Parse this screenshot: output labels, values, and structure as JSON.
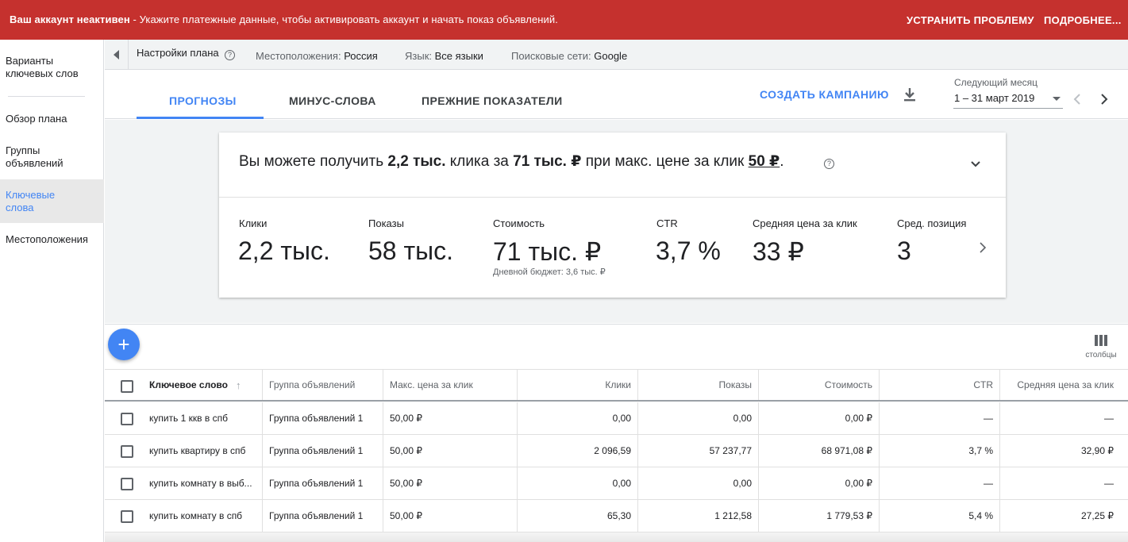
{
  "alert": {
    "title": "Ваш аккаунт неактивен",
    "message": " - Укажите платежные данные, чтобы активировать аккаунт и начать показ объявлений.",
    "fix_label": "УСТРАНИТЬ ПРОБЛЕМУ",
    "more_label": "ПОДРОБНЕЕ...",
    "color": "#c5312e"
  },
  "sidebar": {
    "items": [
      {
        "label": "Варианты ключевых слов"
      },
      {
        "label": "Обзор плана"
      },
      {
        "label": "Группы объявлений"
      },
      {
        "label": "Ключевые слова"
      },
      {
        "label": "Местоположения"
      }
    ]
  },
  "plan_bar": {
    "title": "Настройки плана",
    "location_label": "Местоположения:",
    "location_value": "Россия",
    "language_label": "Язык:",
    "language_value": "Все языки",
    "network_label": "Поисковые сети:",
    "network_value": "Google"
  },
  "tabs": [
    {
      "label": "ПРОГНОЗЫ"
    },
    {
      "label": "МИНУС-СЛОВА"
    },
    {
      "label": "ПРЕЖНИЕ ПОКАЗАТЕЛИ"
    }
  ],
  "header": {
    "create_label": "СОЗДАТЬ КАМПАНИЮ",
    "period_label": "Следующий месяц",
    "period_value": "1 – 31 март 2019",
    "accent": "#4285f4"
  },
  "forecast": {
    "headline_1": "Вы можете получить ",
    "clicks": "2,2 тыс.",
    "headline_2": " клика за ",
    "cost": "71 тыс. ₽",
    "headline_3": " при макс. цене за клик ",
    "max_cpc": "50 ₽",
    "headline_4": ".",
    "metrics": [
      {
        "label": "Клики",
        "value": "2,2 тыс."
      },
      {
        "label": "Показы",
        "value": "58 тыс."
      },
      {
        "label": "Стоимость",
        "value": "71 тыс. ₽",
        "sub": "Дневной бюджет: 3,6 тыс. ₽"
      },
      {
        "label": "CTR",
        "value": "3,7 %"
      },
      {
        "label": "Средняя цена за клик",
        "value": "33 ₽"
      },
      {
        "label": "Сред. позиция",
        "value": "3"
      }
    ]
  },
  "table": {
    "columns_label": "столбцы",
    "headers": [
      "Ключевое слово",
      "Группа объявлений",
      "Макс. цена за клик",
      "Клики",
      "Показы",
      "Стоимость",
      "CTR",
      "Средняя цена за клик"
    ],
    "rows": [
      [
        "купить 1 ккв в спб",
        "Группа объявлений 1",
        "50,00 ₽",
        "0,00",
        "0,00",
        "0,00 ₽",
        "—",
        "—"
      ],
      [
        "купить квартиру в спб",
        "Группа объявлений 1",
        "50,00 ₽",
        "2 096,59",
        "57 237,77",
        "68 971,08 ₽",
        "3,7 %",
        "32,90 ₽"
      ],
      [
        "купить комнату в выб...",
        "Группа объявлений 1",
        "50,00 ₽",
        "0,00",
        "0,00",
        "0,00 ₽",
        "—",
        "—"
      ],
      [
        "купить комнату в спб",
        "Группа объявлений 1",
        "50,00 ₽",
        "65,30",
        "1 212,58",
        "1 779,53 ₽",
        "5,4 %",
        "27,25 ₽"
      ]
    ]
  }
}
